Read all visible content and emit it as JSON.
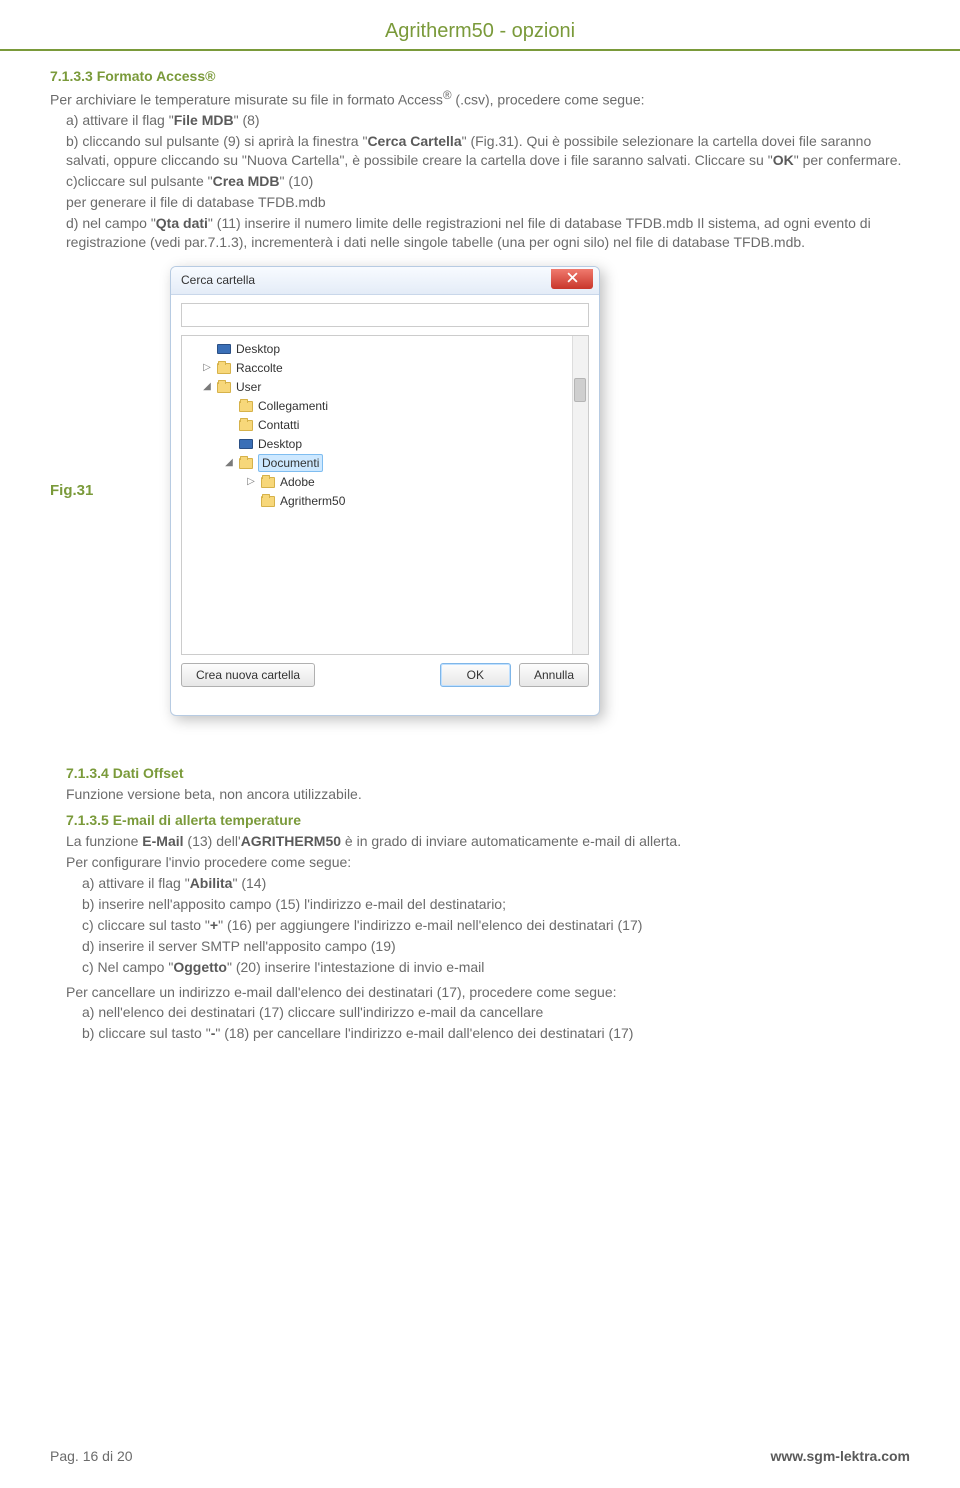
{
  "header": {
    "title": "Agritherm50 - opzioni"
  },
  "section733": {
    "heading": "7.1.3.3 Formato Access®",
    "intro_prefix": "Per archiviare le temperature misurate su file in formato Access",
    "intro_reg": "®",
    "intro_suffix": " (.csv), procedere come segue:",
    "a_prefix": "a) attivare il flag \"",
    "a_bold": "File MDB",
    "a_suffix": "\" (8)",
    "b_prefix": "b) cliccando sul pulsante (9) si aprirà la finestra \"",
    "b_bold": "Cerca Cartella",
    "b_suffix": "\" (Fig.31). Qui è possibile selezionare la cartella dovei file saranno salvati, oppure cliccando su \"Nuova Cartella\", è possibile creare la cartella dove i file saranno salvati. Cliccare su \"",
    "b_bold2": "OK",
    "b_suffix2": "\" per confermare.",
    "c_prefix": "c)cliccare sul pulsante \"",
    "c_bold": "Crea MDB",
    "c_mid": "\" (10)",
    "c_line2": "per generare il file di database TFDB.mdb",
    "d_prefix": "d) nel campo \"",
    "d_bold": "Qta dati",
    "d_suffix": "\" (11) inserire il numero limite delle registrazioni nel file di database TFDB.mdb Il sistema, ad ogni evento di registrazione (vedi par.7.1.3), incrementerà i dati nelle singole tabelle (una per ogni silo) nel file di database TFDB.mdb."
  },
  "figure31": {
    "label": "Fig.31",
    "dialog": {
      "title": "Cerca cartella",
      "tree": [
        {
          "level": 1,
          "arrow": "",
          "icon": "monitor",
          "label": "Desktop"
        },
        {
          "level": 1,
          "arrow": "▷",
          "icon": "folder",
          "label": "Raccolte"
        },
        {
          "level": 1,
          "arrow": "◢",
          "icon": "folder",
          "label": "User"
        },
        {
          "level": 2,
          "arrow": "",
          "icon": "folder",
          "label": "Collegamenti"
        },
        {
          "level": 2,
          "arrow": "",
          "icon": "folder",
          "label": "Contatti"
        },
        {
          "level": 2,
          "arrow": "",
          "icon": "monitor",
          "label": "Desktop"
        },
        {
          "level": 2,
          "arrow": "◢",
          "icon": "folder",
          "label": "Documenti",
          "selected": true
        },
        {
          "level": 3,
          "arrow": "▷",
          "icon": "folder",
          "label": "Adobe"
        },
        {
          "level": 3,
          "arrow": "",
          "icon": "folder",
          "label": "Agritherm50"
        }
      ],
      "btn_new": "Crea nuova cartella",
      "btn_ok": "OK",
      "btn_cancel": "Annulla"
    }
  },
  "section734": {
    "heading": "7.1.3.4 Dati Offset",
    "body": "Funzione versione beta, non ancora utilizzabile."
  },
  "section735": {
    "heading": "7.1.3.5 E-mail di allerta temperature",
    "intro_prefix": "La funzione ",
    "intro_bold1": "E-Mail",
    "intro_mid": " (13) dell'",
    "intro_bold2": "AGRITHERM50",
    "intro_suffix": " è in grado di inviare automaticamente e-mail di allerta.",
    "conf": "Per configurare l'invio procedere come segue:",
    "a_prefix": "a) attivare il flag \"",
    "a_bold": "Abilita",
    "a_suffix": "\" (14)",
    "b": "b) inserire nell'apposito campo (15) l'indirizzo e-mail del destinatario;",
    "c_prefix": "c) cliccare sul tasto \"",
    "c_bold": "+",
    "c_suffix": "\" (16) per aggiungere l'indirizzo e-mail nell'elenco dei destinatari (17)",
    "d": "d) inserire il server SMTP nell'apposito campo (19)",
    "e_prefix": "c) Nel campo \"",
    "e_bold": "Oggetto",
    "e_suffix": "\" (20) inserire l'intestazione di invio e-mail",
    "cancel": "Per cancellare un indirizzo e-mail dall'elenco dei destinatari (17), procedere come segue:",
    "ca": "a) nell'elenco dei destinatari (17) cliccare sull'indirizzo e-mail da cancellare",
    "cb_prefix": "b) cliccare sul tasto \"",
    "cb_bold": "-",
    "cb_suffix": "\" (18) per cancellare l'indirizzo e-mail dall'elenco dei destinatari (17)"
  },
  "footer": {
    "left": "Pag. 16 di 20",
    "right": "www.sgm-lektra.com"
  }
}
